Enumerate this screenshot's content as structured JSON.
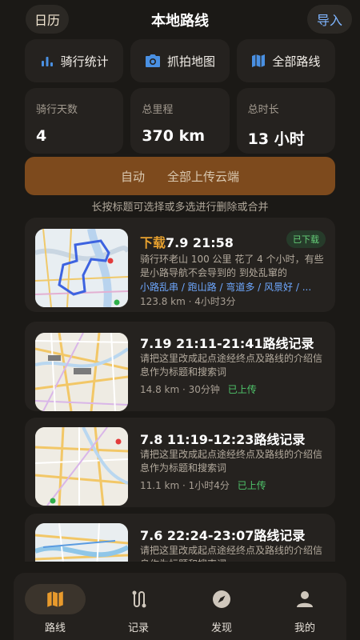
{
  "header": {
    "calendar_label": "日历",
    "title": "本地路线",
    "import_label": "导入"
  },
  "quick_actions": [
    {
      "label": "骑行统计",
      "icon": "bar-chart-icon"
    },
    {
      "label": "抓拍地图",
      "icon": "camera-icon"
    },
    {
      "label": "全部路线",
      "icon": "map-icon"
    }
  ],
  "stats": [
    {
      "label": "骑行天数",
      "value": "4"
    },
    {
      "label": "总里程",
      "value": "370 km"
    },
    {
      "label": "总时长",
      "value": "13 小时"
    }
  ],
  "upload_bar": {
    "mode_label": "自动",
    "action_label": "全部上传云端"
  },
  "hint": "长按标题可选择或多选进行删除或合并",
  "routes": [
    {
      "title_prefix": "下载",
      "title": "7.9 21:58",
      "badge": "已下载",
      "description": "骑行环老山 100 公里  花了 4 个小时，有些是小路导航不会导到的 到处乱窜的",
      "tags": "小路乱串 / 跑山路 / 弯道多 / 风景好 / ...",
      "distance": "123.8 km",
      "duration": "· 4小时3分",
      "status": ""
    },
    {
      "title_prefix": "",
      "title": "7.19 21:11-21:41路线记录",
      "badge": "",
      "description": "请把这里改成起点途经终点及路线的介绍信息作为标题和搜索词",
      "tags": "",
      "distance": "14.8 km",
      "duration": "· 30分钟",
      "status": "已上传"
    },
    {
      "title_prefix": "",
      "title": "7.8 11:19-12:23路线记录",
      "badge": "",
      "description": "请把这里改成起点途经终点及路线的介绍信息作为标题和搜索词",
      "tags": "",
      "distance": "11.1 km",
      "duration": "· 1小时4分",
      "status": "已上传"
    },
    {
      "title_prefix": "",
      "title": "7.6 22:24-23:07路线记录",
      "badge": "",
      "description": "请把这里改成起点途经终点及路线的介绍信息作为标题和搜索词",
      "tags": "",
      "distance": "",
      "duration": "",
      "status": ""
    }
  ],
  "tabbar": [
    {
      "label": "路线",
      "icon": "map-icon",
      "active": true
    },
    {
      "label": "记录",
      "icon": "route-record-icon",
      "active": false
    },
    {
      "label": "发现",
      "icon": "compass-icon",
      "active": false
    },
    {
      "label": "我的",
      "icon": "person-icon",
      "active": false
    }
  ],
  "colors": {
    "background": "#1b1916",
    "card": "#25221f",
    "accent_orange": "#e7a12f",
    "upload_bar": "#7d4a1d",
    "link_blue": "#6ea8ff",
    "status_green": "#4fc46a"
  }
}
